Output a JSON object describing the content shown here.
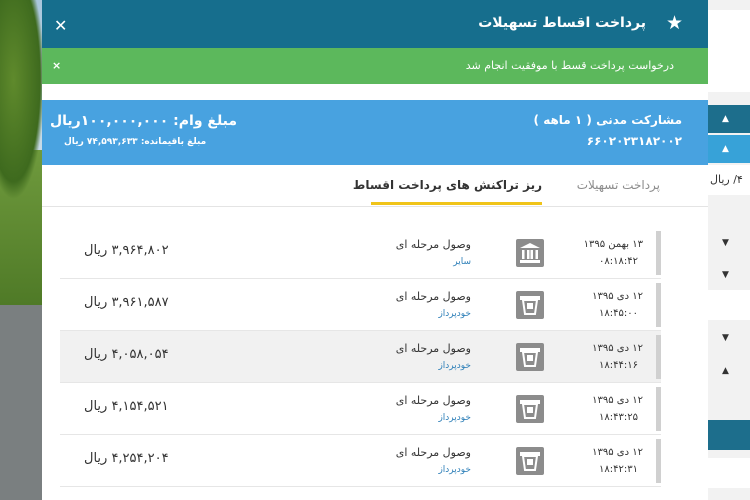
{
  "modal": {
    "title": "پرداخت اقساط تسهیلات",
    "alert": "درخواست پرداخت قسط با موفقیت انجام شد",
    "close_symbol": "✕",
    "alert_close_symbol": "×"
  },
  "summary": {
    "facility_title": "مشارکت مدنی ( ۱ ماهه )",
    "account_number": "۶۶۰۲۰۲۳۱۸۲۰۰۲",
    "loan_amount": "مبلغ وام: ۱۰۰,۰۰۰,۰۰۰ریال",
    "remaining_amount": "مبلغ باقیمانده: ۷۴,۵۹۳,۶۳۳ ریال"
  },
  "tabs": [
    {
      "label": "پرداخت تسهیلات",
      "active": false
    },
    {
      "label": "ریز تراکنش های پرداخت اقساط",
      "active": true
    }
  ],
  "transactions": [
    {
      "date": "۱۳ بهمن ۱۳۹۵",
      "time": "۰۸:۱۸:۴۲",
      "type": "وصول مرحله ای",
      "source": "سایر",
      "amount": "۳,۹۶۴,۸۰۲ ریال",
      "icon": "bank-icon"
    },
    {
      "date": "۱۲ دی ۱۳۹۵",
      "time": "۱۸:۴۵:۰۰",
      "type": "وصول مرحله ای",
      "source": "خودپرداز",
      "amount": "۳,۹۶۱,۵۸۷ ریال",
      "icon": "atm-icon"
    },
    {
      "date": "۱۲ دی ۱۳۹۵",
      "time": "۱۸:۴۴:۱۶",
      "type": "وصول مرحله ای",
      "source": "خودپرداز",
      "amount": "۴,۰۵۸,۰۵۴ ریال",
      "icon": "atm-icon"
    },
    {
      "date": "۱۲ دی ۱۳۹۵",
      "time": "۱۸:۴۳:۲۵",
      "type": "وصول مرحله ای",
      "source": "خودپرداز",
      "amount": "۴,۱۵۴,۵۲۱ ریال",
      "icon": "atm-icon"
    },
    {
      "date": "۱۲ دی ۱۳۹۵",
      "time": "۱۸:۴۲:۳۱",
      "type": "وصول مرحله ای",
      "source": "خودپرداز",
      "amount": "۴,۲۵۴,۲۰۴ ریال",
      "icon": "atm-icon"
    }
  ],
  "right_strip": {
    "partial_text": "۴/ ریال",
    "up_arrow": "▲",
    "down_arrow": "▼"
  },
  "colors": {
    "header": "#166e8d",
    "alert": "#5cb85c",
    "summary": "#48a2e0",
    "tab_underline": "#f0c419",
    "source_link": "#2d7fb8"
  }
}
